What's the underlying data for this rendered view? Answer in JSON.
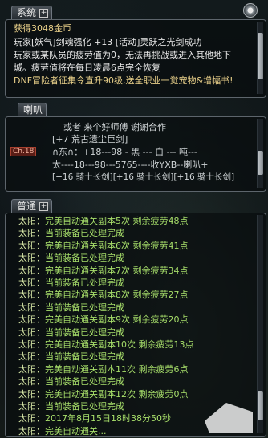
{
  "system": {
    "tab_label": "系统",
    "lines": [
      "获得3048金币",
      "玩家[妖气]剑魂强化 +13 [活动]灵跃之光剑成功",
      "玩家或某队员的疲劳值为0，无法再挑战或进入其他地下",
      "城。疲劳值将在每日凌晨6点完全恢复",
      "DNF冒险者征集令直升90级,送全职业一觉宠物&增幅书!"
    ]
  },
  "horn": {
    "tab_label": "喇叭",
    "lines": [
      "或者  来个好师傅    谢谢合作",
      "[+7  荒古遗尘巨剑]",
      "∩东∩：+18---98    -    黑 --- 白 --- 吨---",
      "太----18---98---5765----收YXB--喇叭+",
      "[+16  骑士长剑][+16  骑士长剑][+16  骑士长剑]"
    ],
    "channel_badge": "Ch.18"
  },
  "normal": {
    "tab_label": "普通",
    "messages": [
      {
        "speaker": "太阳：",
        "text": "完美自动通关副本5次    剩余疲劳48点"
      },
      {
        "speaker": "太阳：",
        "text": "当前装备已处理完成"
      },
      {
        "speaker": "太阳：",
        "text": "完美自动通关副本6次    剩余疲劳41点"
      },
      {
        "speaker": "太阳：",
        "text": "当前装备已处理完成"
      },
      {
        "speaker": "太阳：",
        "text": "完美自动通关副本7次    剩余疲劳34点"
      },
      {
        "speaker": "太阳：",
        "text": "当前装备已处理完成"
      },
      {
        "speaker": "太阳：",
        "text": "完美自动通关副本8次    剩余疲劳27点"
      },
      {
        "speaker": "太阳：",
        "text": "当前装备已处理完成"
      },
      {
        "speaker": "太阳：",
        "text": "完美自动通关副本9次    剩余疲劳20点"
      },
      {
        "speaker": "太阳：",
        "text": "当前装备已处理完成"
      },
      {
        "speaker": "太阳：",
        "text": "完美自动通关副本10次    剩余疲劳13点"
      },
      {
        "speaker": "太阳：",
        "text": "当前装备已处理完成"
      },
      {
        "speaker": "太阳：",
        "text": "完美自动通关副本11次    剩余疲劳6点"
      },
      {
        "speaker": "太阳：",
        "text": "当前装备已处理完成"
      },
      {
        "speaker": "太阳：",
        "text": "完美自动通关副本12次    剩余疲劳0点"
      },
      {
        "speaker": "太阳：",
        "text": "当前装备已处理完成"
      },
      {
        "speaker": "太阳：",
        "text": "2017年8月15日18时38分50秒"
      },
      {
        "speaker": "太阳：",
        "text": "完美自动通关..."
      }
    ]
  }
}
